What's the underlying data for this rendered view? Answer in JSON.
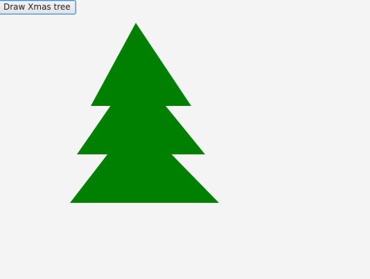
{
  "toolbar": {
    "draw_button_label": "Draw Xmas tree"
  },
  "tree": {
    "color": "#008000"
  },
  "colors": {
    "background": "#f4f4f4",
    "button_border": "#3d8ee0"
  }
}
